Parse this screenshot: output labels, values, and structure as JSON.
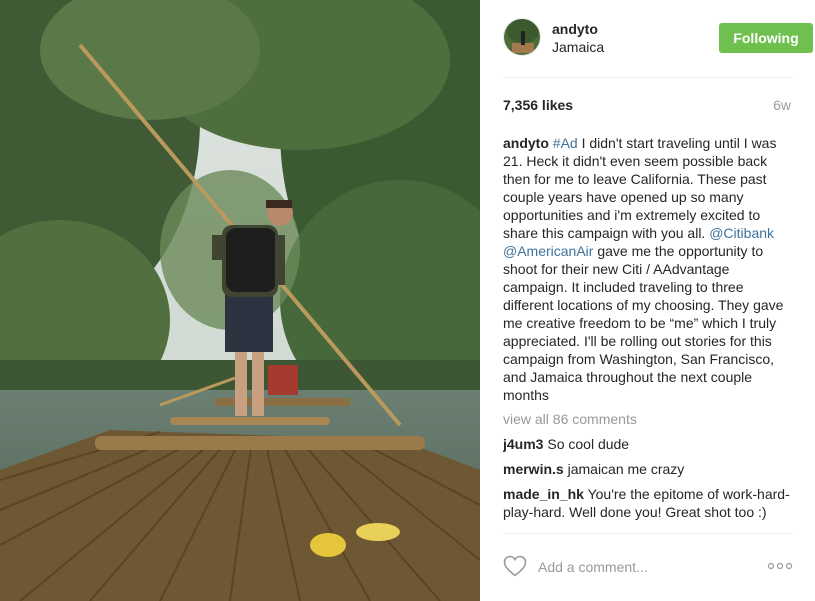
{
  "post": {
    "image_description_icon": "photo-bamboo-raft",
    "header": {
      "username": "andyto",
      "location": "Jamaica",
      "follow_label": "Following"
    },
    "likes": "7,356 likes",
    "time": "6w",
    "caption": {
      "username": "andyto",
      "hashtag": "#Ad",
      "text_1": " I didn't start traveling until I was 21. Heck it didn't even seem possible back then for me to leave California. These past couple years have opened up so many opportunities and i'm extremely excited to share this campaign with you all. ",
      "mention_1": "@Citibank",
      "mention_2": "@AmericanAir",
      "text_2": " gave me the opportunity to shoot for their new Citi / AAdvantage campaign. It included traveling to three different locations of my choosing. They gave me creative freedom to be “me” which I truly appreciated. I'll be rolling out stories for this campaign from Washington, San Francisco, and Jamaica throughout the next couple months"
    },
    "view_all": "view all 86 comments",
    "comments": [
      {
        "username": "j4um3",
        "text": " So cool dude"
      },
      {
        "username": "merwin.s",
        "text": " jamaican me crazy"
      },
      {
        "username": "made_in_hk",
        "text": " You're the epitome of work-hard-play-hard. Well done you! Great shot too :)"
      }
    ],
    "add_comment_placeholder": "Add a comment...",
    "colors": {
      "follow_button": "#70c050",
      "link": "#3f729b",
      "muted": "#999999"
    }
  }
}
